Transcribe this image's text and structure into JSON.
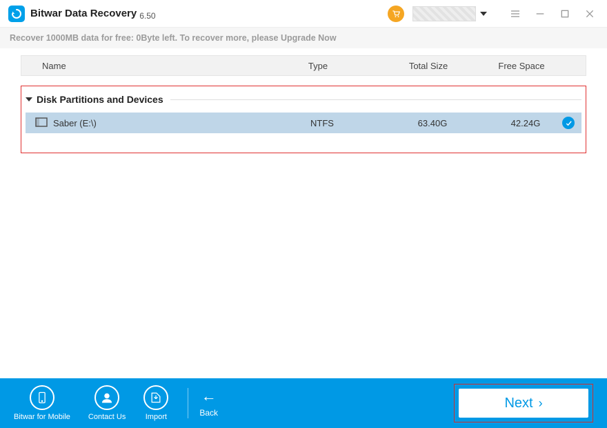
{
  "app": {
    "title": "Bitwar Data Recovery",
    "version": "6.50"
  },
  "promo": "Recover 1000MB data for free: 0Byte left. To recover more, please Upgrade Now",
  "columns": {
    "name": "Name",
    "type": "Type",
    "size": "Total Size",
    "free": "Free Space"
  },
  "section": {
    "title": "Disk Partitions and Devices"
  },
  "partitions": [
    {
      "name": "Saber (E:\\)",
      "type": "NTFS",
      "size": "63.40G",
      "free": "42.24G",
      "selected": true
    }
  ],
  "bottom": {
    "mobile": "Bitwar for Mobile",
    "contact": "Contact Us",
    "import": "Import",
    "back": "Back",
    "next": "Next"
  }
}
